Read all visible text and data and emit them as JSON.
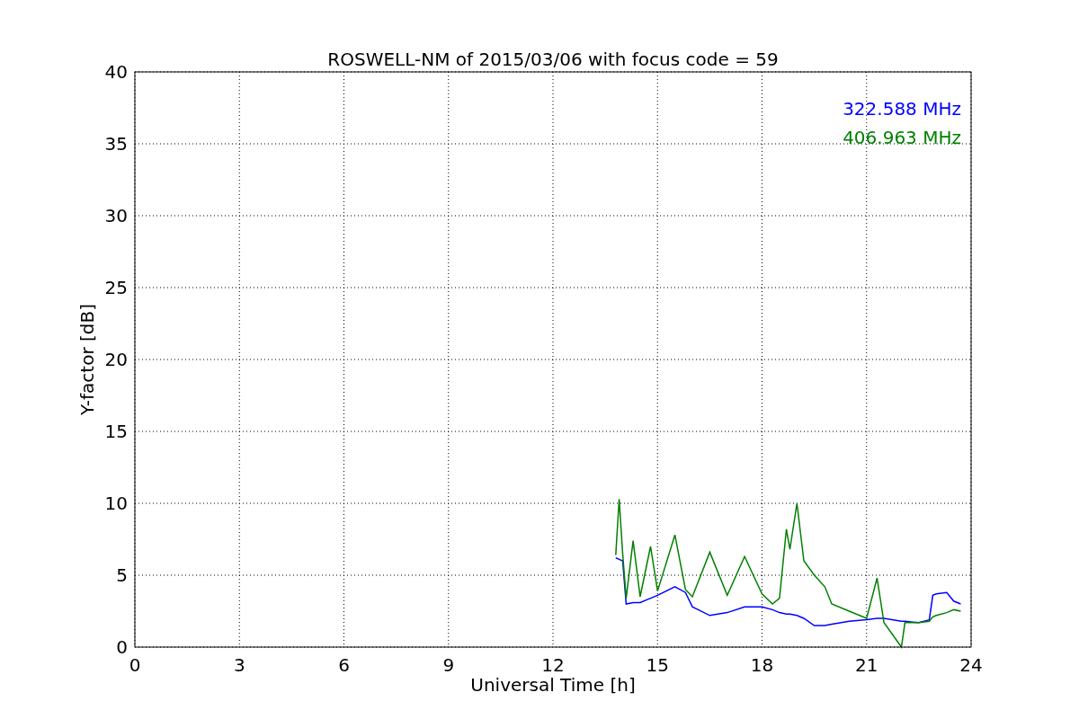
{
  "figure": {
    "chart_data": {
      "type": "line",
      "title": "ROSWELL-NM of 2015/03/06 with focus code = 59",
      "xlabel": "Universal Time [h]",
      "ylabel": "Y-factor [dB]",
      "x": [
        13.8,
        13.9,
        14.0,
        14.1,
        14.3,
        14.5,
        14.8,
        15.0,
        15.5,
        15.8,
        16.0,
        16.5,
        17.0,
        17.5,
        18.0,
        18.3,
        18.5,
        18.7,
        18.8,
        19.0,
        19.2,
        19.5,
        19.8,
        20.0,
        20.5,
        21.0,
        21.3,
        21.5,
        22.0,
        22.1,
        22.5,
        22.8,
        22.9,
        23.0,
        23.3,
        23.5,
        23.7
      ],
      "series": [
        {
          "name": "322.588 MHz",
          "color": "#0000ff",
          "values": [
            6.2,
            6.1,
            6.0,
            3.0,
            3.1,
            3.1,
            3.4,
            3.6,
            4.2,
            3.8,
            2.8,
            2.2,
            2.4,
            2.8,
            2.8,
            2.6,
            2.4,
            2.3,
            2.3,
            2.2,
            2.0,
            1.5,
            1.5,
            1.6,
            1.8,
            1.9,
            2.0,
            2.0,
            1.8,
            1.8,
            1.7,
            1.9,
            3.6,
            3.7,
            3.8,
            3.2,
            3.0
          ]
        },
        {
          "name": "406.963 MHz",
          "color": "#008000",
          "values": [
            6.4,
            10.3,
            6.5,
            3.4,
            7.4,
            3.5,
            7.0,
            3.9,
            7.8,
            4.0,
            3.5,
            6.6,
            3.6,
            6.3,
            3.7,
            3.0,
            3.4,
            8.2,
            6.8,
            10.0,
            6.0,
            5.0,
            4.2,
            3.0,
            2.5,
            2.0,
            4.8,
            1.7,
            0.0,
            1.7,
            1.7,
            1.8,
            2.1,
            2.2,
            2.4,
            2.6,
            2.5
          ]
        }
      ],
      "xlim": [
        0,
        24
      ],
      "ylim": [
        0,
        40
      ],
      "xticks": [
        0,
        3,
        6,
        9,
        12,
        15,
        18,
        21,
        24
      ],
      "yticks": [
        0,
        5,
        10,
        15,
        20,
        25,
        30,
        35,
        40
      ],
      "grid": true
    }
  }
}
